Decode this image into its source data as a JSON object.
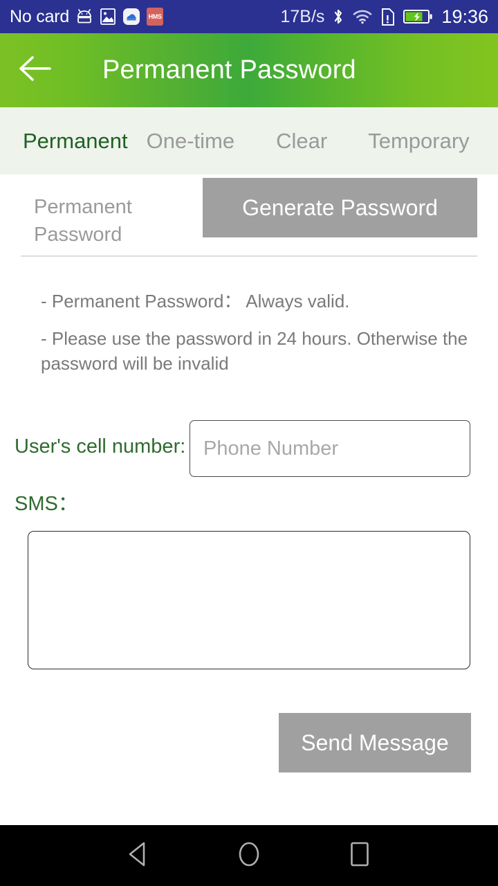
{
  "status_bar": {
    "carrier_text": "No card",
    "network_speed": "17B/s",
    "clock": "19:36",
    "hms_label": "HMS",
    "icons": [
      "android-robot-icon",
      "screenshot-icon",
      "cloud-app-icon",
      "hms-icon",
      "bluetooth-icon",
      "wifi-icon",
      "sim-card-alert-icon",
      "battery-charging-icon"
    ],
    "background_color": "#2a3191"
  },
  "header": {
    "title": "Permanent Password",
    "back_icon": "arrow-left-icon",
    "gradient_start": "#7cc124",
    "gradient_mid": "#3daa3a",
    "gradient_end": "#83c41f"
  },
  "tabs": {
    "active_index": 0,
    "active_color": "#1f6122",
    "inactive_color": "#9a9a9a",
    "items": [
      {
        "label": "Permanent"
      },
      {
        "label": "One-time"
      },
      {
        "label": "Clear"
      },
      {
        "label": "Temporary"
      }
    ]
  },
  "subtabs": {
    "permanent_password_label": "Permanent Password",
    "generate_password_label": "Generate Password",
    "button_color": "#a0a0a0"
  },
  "notes": {
    "line1": "- Permanent Password：  Always valid.",
    "line2": "- Please use the password in 24 hours. Otherwise the password will be invalid"
  },
  "form": {
    "cell_label": "User's cell number:",
    "phone_placeholder": "Phone Number",
    "phone_value": "",
    "sms_label": "SMS：",
    "sms_value": "",
    "sms_placeholder": "",
    "label_color": "#2f6b2f"
  },
  "actions": {
    "send_message_label": "Send Message",
    "button_color": "#a0a0a0"
  },
  "nav_bar": {
    "back_icon": "triangle-back-icon",
    "home_icon": "circle-home-icon",
    "recents_icon": "square-recents-icon",
    "background_color": "#000000"
  }
}
